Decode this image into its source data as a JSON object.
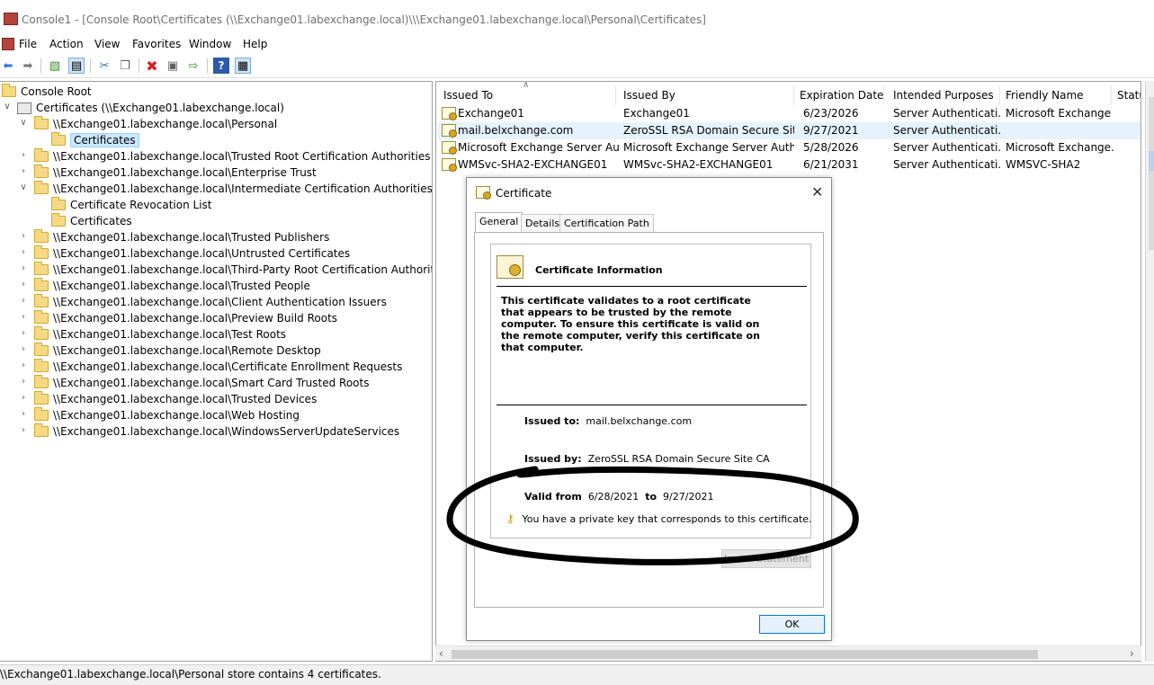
{
  "window": {
    "title": "Console1 - [Console Root\\Certificates (\\\\Exchange01.labexchange.local)\\\\\\Exchange01.labexchange.local\\Personal\\Certificates]"
  },
  "menu": [
    "File",
    "Action",
    "View",
    "Favorites",
    "Window",
    "Help"
  ],
  "tree": {
    "root": "Console Root",
    "certificates_node": "Certificates (\\\\Exchange01.labexchange.local)",
    "items": [
      {
        "label": "\\\\Exchange01.labexchange.local\\Personal",
        "expanded": true
      },
      {
        "label": "Certificates",
        "child": true,
        "selected": true
      },
      {
        "label": "\\\\Exchange01.labexchange.local\\Trusted Root Certification Authorities"
      },
      {
        "label": "\\\\Exchange01.labexchange.local\\Enterprise Trust"
      },
      {
        "label": "\\\\Exchange01.labexchange.local\\Intermediate Certification Authorities",
        "expanded": true
      },
      {
        "label": "Certificate Revocation List",
        "child": true
      },
      {
        "label": "Certificates",
        "child": true
      },
      {
        "label": "\\\\Exchange01.labexchange.local\\Trusted Publishers"
      },
      {
        "label": "\\\\Exchange01.labexchange.local\\Untrusted Certificates"
      },
      {
        "label": "\\\\Exchange01.labexchange.local\\Third-Party Root Certification Authorities"
      },
      {
        "label": "\\\\Exchange01.labexchange.local\\Trusted People"
      },
      {
        "label": "\\\\Exchange01.labexchange.local\\Client Authentication Issuers"
      },
      {
        "label": "\\\\Exchange01.labexchange.local\\Preview Build Roots"
      },
      {
        "label": "\\\\Exchange01.labexchange.local\\Test Roots"
      },
      {
        "label": "\\\\Exchange01.labexchange.local\\Remote Desktop"
      },
      {
        "label": "\\\\Exchange01.labexchange.local\\Certificate Enrollment Requests"
      },
      {
        "label": "\\\\Exchange01.labexchange.local\\Smart Card Trusted Roots"
      },
      {
        "label": "\\\\Exchange01.labexchange.local\\Trusted Devices"
      },
      {
        "label": "\\\\Exchange01.labexchange.local\\Web Hosting"
      },
      {
        "label": "\\\\Exchange01.labexchange.local\\WindowsServerUpdateServices"
      }
    ]
  },
  "list": {
    "columns": [
      "Issued To",
      "Issued By",
      "Expiration Date",
      "Intended Purposes",
      "Friendly Name",
      "Statu"
    ],
    "rows": [
      [
        "Exchange01",
        "Exchange01",
        "6/23/2026",
        "Server Authenticati...",
        "Microsoft Exchange"
      ],
      [
        "mail.belxchange.com",
        "ZeroSSL RSA Domain Secure Site ...",
        "9/27/2021",
        "Server Authenticati...",
        ""
      ],
      [
        "Microsoft Exchange Server Aut...",
        "Microsoft Exchange Server Auth C...",
        "5/28/2026",
        "Server Authenticati...",
        "Microsoft Exchange..."
      ],
      [
        "WMSvc-SHA2-EXCHANGE01",
        "WMSvc-SHA2-EXCHANGE01",
        "6/21/2031",
        "Server Authenticati...",
        "WMSVC-SHA2"
      ]
    ]
  },
  "status": "\\\\Exchange01.labexchange.local\\Personal store contains 4 certificates.",
  "dialog": {
    "title": "Certificate",
    "tabs": [
      "General",
      "Details",
      "Certification Path"
    ],
    "info_title": "Certificate Information",
    "info_text": "This certificate validates to a root certificate that appears to be trusted by the remote computer. To ensure this certificate is valid on the remote computer, verify this certificate on that computer.",
    "issued_to_label": "Issued to:",
    "issued_to": "mail.belxchange.com",
    "issued_by_label": "Issued by:",
    "issued_by": "ZeroSSL RSA Domain Secure Site CA",
    "valid_from_label": "Valid from",
    "valid_from": "6/28/2021",
    "to_label": "to",
    "valid_to": "9/27/2021",
    "private_key_note": "You have a private key that corresponds to this certificate.",
    "issuer_statement_label": "Issuer Statement",
    "ok_label": "OK"
  },
  "icons": {
    "back": "back-arrow-icon",
    "forward": "forward-arrow-icon",
    "delete": "delete-x-icon",
    "help": "help-icon",
    "key": "key-icon"
  },
  "colors": {
    "selection": "#cce8ff",
    "delete": "#d62020",
    "annotation": "#000000"
  }
}
